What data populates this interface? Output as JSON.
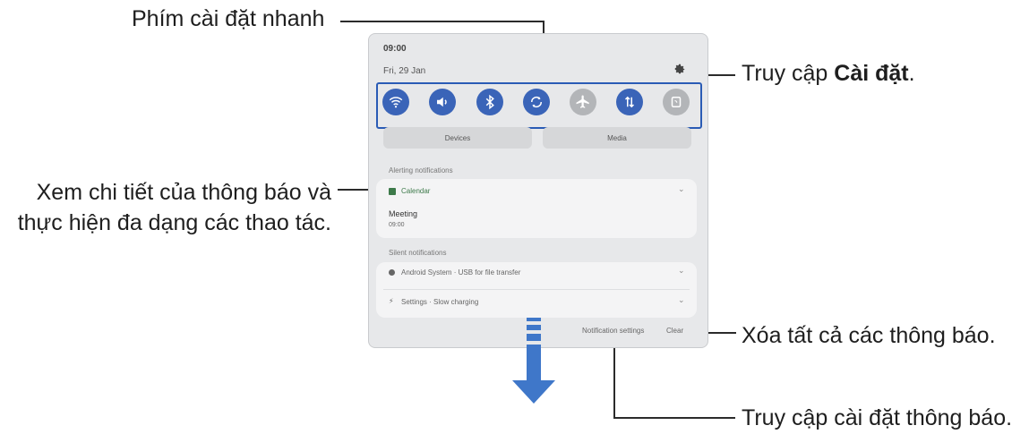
{
  "callouts": {
    "quick_settings": "Phím cài đặt nhanh",
    "settings_prefix": "Truy cập ",
    "settings_bold": "Cài đặt",
    "settings_suffix": ".",
    "notification_detail_line1": "Xem chi tiết của thông báo và",
    "notification_detail_line2": "thực hiện đa dạng các thao tác.",
    "clear_all": "Xóa tất cả các thông báo.",
    "notification_settings": "Truy cập cài đặt thông báo."
  },
  "panel": {
    "time": "09:00",
    "date": "Fri, 29 Jan",
    "quick_settings": [
      {
        "icon": "wifi-icon",
        "state": "on"
      },
      {
        "icon": "sound-icon",
        "state": "on"
      },
      {
        "icon": "bluetooth-icon",
        "state": "on"
      },
      {
        "icon": "auto-rotate-icon",
        "state": "on"
      },
      {
        "icon": "airplane-icon",
        "state": "off"
      },
      {
        "icon": "mobile-data-icon",
        "state": "on"
      },
      {
        "icon": "nfc-icon",
        "state": "off"
      }
    ],
    "devices_label": "Devices",
    "media_label": "Media",
    "alerting_header": "Alerting notifications",
    "calendar_app": "Calendar",
    "meeting_title": "Meeting",
    "meeting_time": "09:00",
    "silent_header": "Silent notifications",
    "android_system_text": "Android System · USB for file transfer",
    "settings_text": "Settings · Slow charging",
    "notification_settings_btn": "Notification settings",
    "clear_btn": "Clear"
  },
  "colors": {
    "accent": "#3a64b8",
    "arrow": "#3f77c9",
    "highlight_border": "#2a5bb5"
  }
}
